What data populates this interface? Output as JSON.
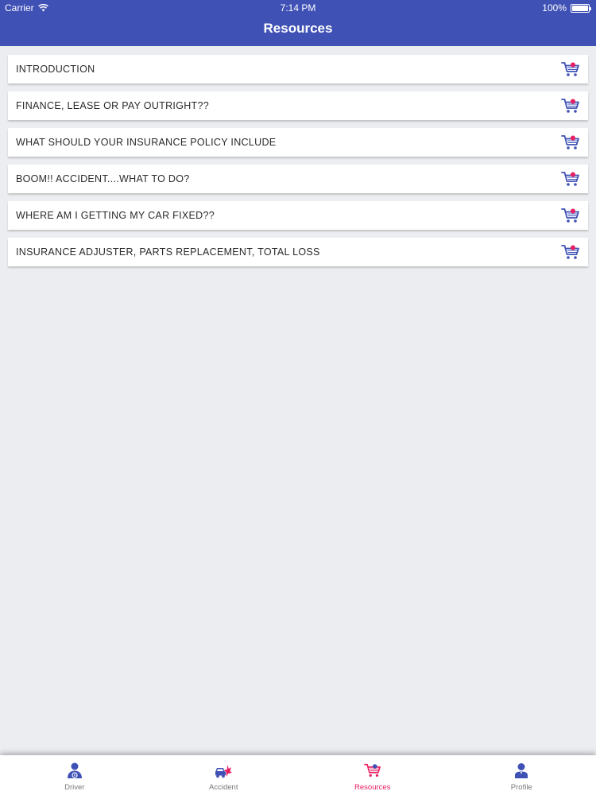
{
  "status_bar": {
    "carrier": "Carrier",
    "time": "7:14 PM",
    "battery": "100%"
  },
  "header": {
    "title": "Resources"
  },
  "resources": {
    "items": [
      {
        "label": "INTRODUCTION",
        "icon": "cart-icon"
      },
      {
        "label": "FINANCE, LEASE OR PAY OUTRIGHT??",
        "icon": "cart-icon"
      },
      {
        "label": "WHAT SHOULD YOUR INSURANCE POLICY INCLUDE",
        "icon": "cart-icon"
      },
      {
        "label": "BOOM!!  ACCIDENT....WHAT TO DO?",
        "icon": "cart-icon"
      },
      {
        "label": "WHERE AM I GETTING MY CAR FIXED??",
        "icon": "cart-icon"
      },
      {
        "label": "INSURANCE ADJUSTER, PARTS REPLACEMENT, TOTAL LOSS",
        "icon": "cart-icon"
      }
    ]
  },
  "tabbar": {
    "tabs": [
      {
        "label": "Driver",
        "icon": "driver-icon",
        "active": false
      },
      {
        "label": "Accident",
        "icon": "accident-car-icon",
        "active": false
      },
      {
        "label": "Resources",
        "icon": "cart-icon",
        "active": true
      },
      {
        "label": "Profile",
        "icon": "profile-icon",
        "active": false
      }
    ]
  },
  "colors": {
    "header": "#3f51b5",
    "accent": "#e91e63",
    "icon_blue": "#3f51b5",
    "background": "#ebedf0"
  }
}
